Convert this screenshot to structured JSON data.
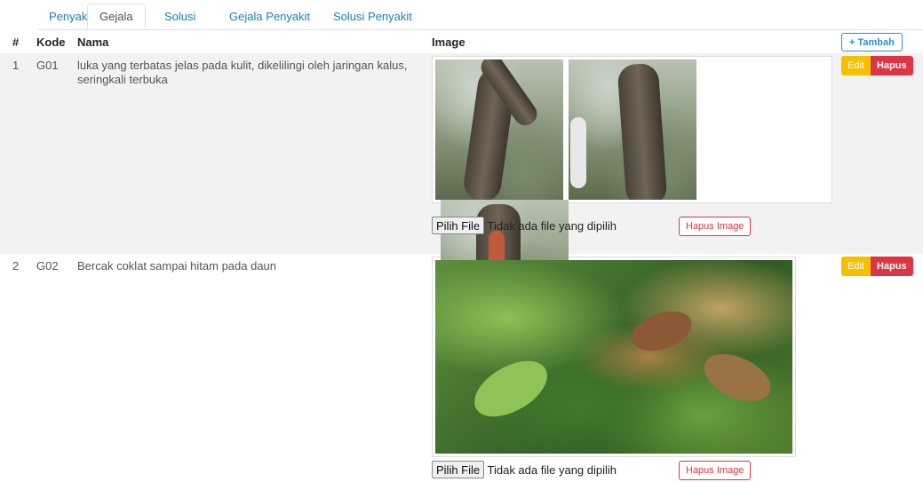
{
  "tabs": [
    "Penyakit",
    "Gejala",
    "Solusi",
    "Gejala Penyakit",
    "Solusi Penyakit"
  ],
  "active_tab": "Gejala",
  "table": {
    "headers": {
      "num": "#",
      "kode": "Kode",
      "nama": "Nama",
      "image": "Image"
    },
    "add_button": "+ Tambah",
    "rows": [
      {
        "num": "1",
        "kode": "G01",
        "nama": "luka yang terbatas jelas pada kulit, dikelilingi oleh jaringan kalus, seringkali terbuka",
        "file_button": "Pilih File",
        "file_status": "Tidak ada file yang dipilih",
        "remove_image": "Hapus Image",
        "edit": "Edit",
        "delete": "Hapus"
      },
      {
        "num": "2",
        "kode": "G02",
        "nama": "Bercak coklat sampai hitam pada daun",
        "file_button": "Pilih File",
        "file_status": "Tidak ada file yang dipilih",
        "remove_image": "Hapus Image",
        "edit": "Edit",
        "delete": "Hapus"
      }
    ]
  },
  "colors": {
    "edit": "#f5c000",
    "delete": "#dc3545",
    "link": "#1a7fc1"
  }
}
